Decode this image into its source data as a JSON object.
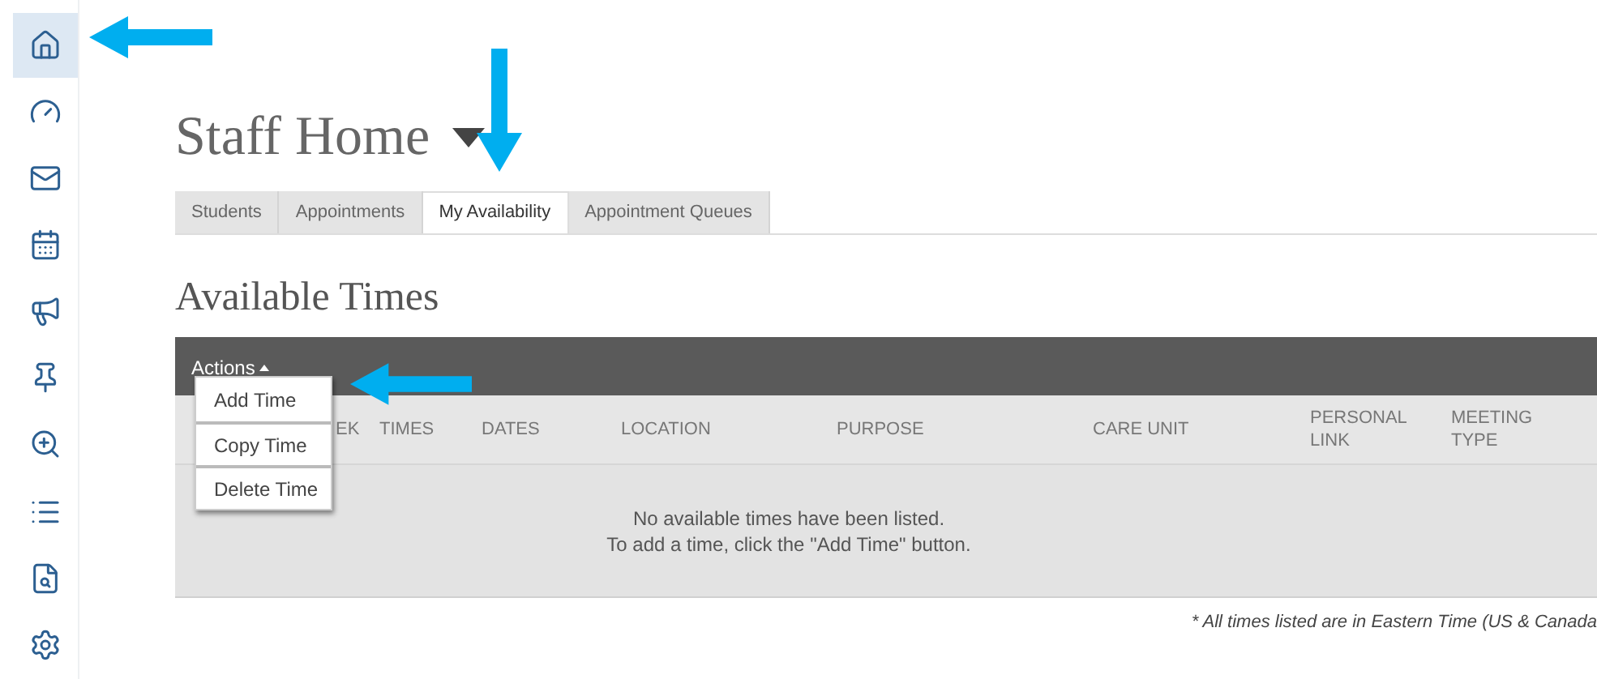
{
  "sidebar": {
    "items": [
      {
        "selected": true
      },
      {
        "selected": false
      },
      {
        "selected": false
      },
      {
        "selected": false
      },
      {
        "selected": false
      },
      {
        "selected": false
      },
      {
        "selected": false
      },
      {
        "selected": false
      },
      {
        "selected": false
      },
      {
        "selected": false
      }
    ]
  },
  "page_title": "Staff Home",
  "tabs": [
    {
      "label": "Students",
      "selected": false
    },
    {
      "label": "Appointments",
      "selected": false
    },
    {
      "label": "My Availability",
      "selected": true
    },
    {
      "label": "Appointment Queues",
      "selected": false
    }
  ],
  "section_title": "Available Times",
  "actions": {
    "label": "Actions",
    "expanded": true,
    "menu": [
      "Add Time",
      "Copy Time",
      "Delete Time"
    ]
  },
  "table": {
    "columns": [
      "EK",
      "TIMES",
      "DATES",
      "LOCATION",
      "PURPOSE",
      "CARE UNIT",
      "PERSONAL LINK",
      "MEETING TYPE"
    ],
    "empty_message": [
      "No available times have been listed.",
      "To add a time, click the \"Add Time\" button."
    ]
  },
  "footnote": "* All times listed are in Eastern Time (US & Canada"
}
